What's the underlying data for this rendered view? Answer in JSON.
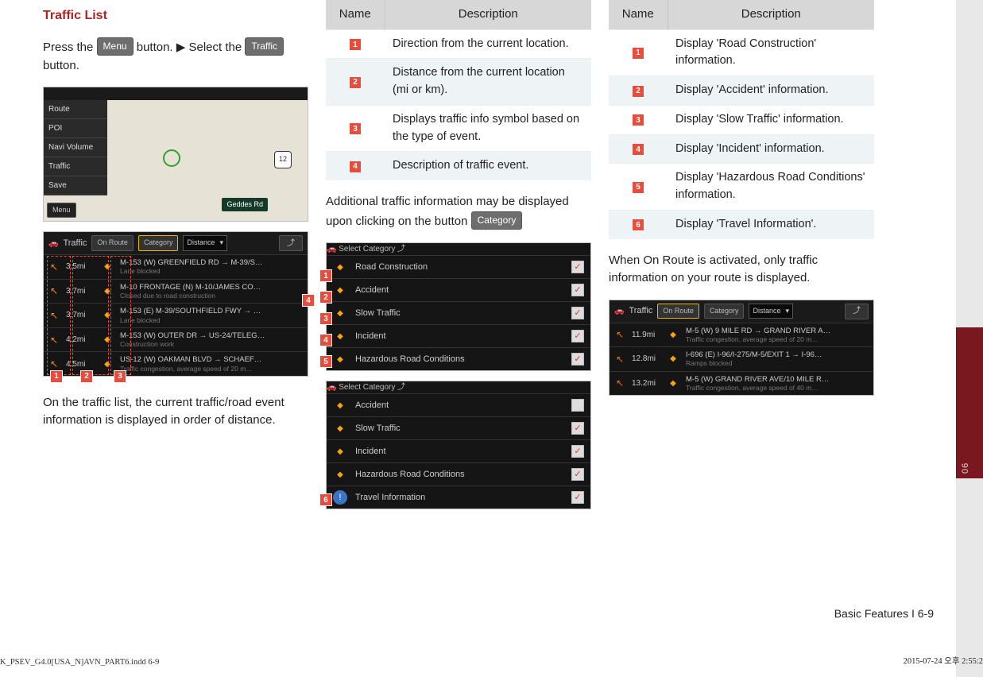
{
  "col1": {
    "heading": "Traffic List",
    "para1_a": "Press the ",
    "btn_menu": "Menu",
    "para1_b": " button. ▶ Select the ",
    "btn_traffic": "Traffic",
    "para1_c": " button.",
    "map": {
      "side_items": [
        "Route",
        "POI",
        "Navi Volume",
        "Traffic",
        "Save"
      ],
      "menu_btn": "Menu",
      "road_label": "Geddes Rd",
      "hwy_shield": "12"
    },
    "traffic": {
      "title": "Traffic",
      "tab_onroute": "On Route",
      "tab_category": "Category",
      "dropdown": "Distance",
      "rows": [
        {
          "dist": "3.5mi",
          "title": "M-153 (W) GREENFIELD RD → M-39/S…",
          "sub": "Lane blocked"
        },
        {
          "dist": "3.7mi",
          "title": "M-10 FRONTAGE (N) M-10/JAMES CO…",
          "sub": "Closed due to road construction"
        },
        {
          "dist": "3.7mi",
          "title": "M-153 (E) M-39/SOUTHFIELD FWY → …",
          "sub": "Lane blocked"
        },
        {
          "dist": "4.2mi",
          "title": "M-153 (W) OUTER DR → US-24/TELEG…",
          "sub": "Construction work"
        },
        {
          "dist": "4.5mi",
          "title": "US-12 (W) OAKMAN BLVD → SCHAEF…",
          "sub": "Traffic congestion, average speed of 20 m…"
        }
      ]
    },
    "para2": "On the traffic list, the current traffic/road event information is displayed in order of distance."
  },
  "col2": {
    "table": {
      "h1": "Name",
      "h2": "Description",
      "rows": [
        "Direction from the current location.",
        "Distance from the current location (mi or km).",
        "Displays traffic info symbol based on the type of event.",
        "Description of traffic event."
      ]
    },
    "para1_a": "Additional traffic information may be displayed upon clicking on the button ",
    "btn_category": "Category",
    "cat1": {
      "title": "Select Category",
      "rows": [
        "Road Construction",
        "Accident",
        "Slow Traffic",
        "Incident",
        "Hazardous Road Conditions"
      ]
    },
    "cat2": {
      "title": "Select Category",
      "rows": [
        "Accident",
        "Slow Traffic",
        "Incident",
        "Hazardous Road Conditions",
        "Travel Information"
      ]
    }
  },
  "col3": {
    "table": {
      "h1": "Name",
      "h2": "Description",
      "rows": [
        "Display 'Road Construction' information.",
        "Display 'Accident' information.",
        "Display 'Slow Traffic' information.",
        "Display 'Incident' information.",
        "Display 'Hazardous Road Conditions' information.",
        "Display 'Travel Information'."
      ]
    },
    "para1": "When On Route is activated, only traffic information on your route is displayed.",
    "traffic": {
      "title": "Traffic",
      "tab_onroute": "On Route",
      "tab_category": "Category",
      "dropdown": "Distance",
      "rows": [
        {
          "dist": "11.9mi",
          "title": "M-5 (W) 9 MILE RD → GRAND RIVER A…",
          "sub": "Traffic congestion, average speed of 20 m…"
        },
        {
          "dist": "12.8mi",
          "title": "I-696 (E) I-96/I-275/M-5/EXIT 1 → I-96…",
          "sub": "Ramps blocked"
        },
        {
          "dist": "13.2mi",
          "title": "M-5 (W) GRAND RIVER AVE/10 MILE R…",
          "sub": "Traffic congestion, average speed of 40 m…"
        }
      ]
    }
  },
  "side_tab": "06",
  "footer_right": "Basic Features I 6-9",
  "indd_left": "K_PSEV_G4.0[USA_N]AVN_PART6.indd   6-9",
  "indd_right": "2015-07-24   오후 2:55:2"
}
